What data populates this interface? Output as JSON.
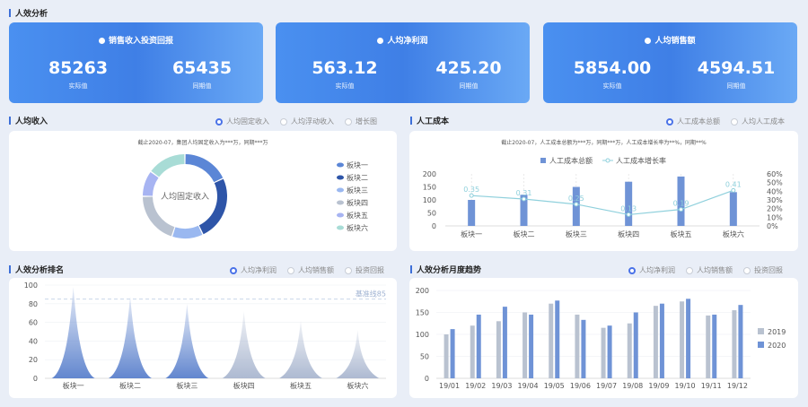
{
  "section_titles": {
    "overview": "人效分析",
    "income": "人均收入",
    "labor_cost": "人工成本",
    "ranking": "人效分析排名",
    "monthly": "人效分析月度趋势"
  },
  "kpis": [
    {
      "title": "销售收入投资回报",
      "actual": "85263",
      "actual_label": "实际值",
      "prior": "65435",
      "prior_label": "同期值"
    },
    {
      "title": "人均净利润",
      "actual": "563.12",
      "actual_label": "实际值",
      "prior": "425.20",
      "prior_label": "同期值"
    },
    {
      "title": "人均销售额",
      "actual": "5854.00",
      "actual_label": "实际值",
      "prior": "4594.51",
      "prior_label": "同期值"
    }
  ],
  "income_panel": {
    "radios": [
      "人均固定收入",
      "人均浮动收入",
      "增长图"
    ],
    "selected": 0,
    "note": "截止2020-07，集团人均固定收入为***万，同期***万"
  },
  "labor_panel": {
    "radios": [
      "人工成本总额",
      "人均人工成本"
    ],
    "selected": 0,
    "note": "截止2020-07，人工成本总额为***万，同期***万，人工成本增长率为**%，同期**%"
  },
  "ranking_panel": {
    "radios": [
      "人均净利润",
      "人均销售额",
      "投资回报"
    ],
    "selected": 0
  },
  "monthly_panel": {
    "radios": [
      "人均净利润",
      "人均销售额",
      "投资回报"
    ],
    "selected": 0
  },
  "colors": {
    "accent": "#4a72e8",
    "dark_blue": "#2e55a8",
    "bar_blue": "#6f93d6",
    "line_cyan": "#8fd0dc"
  },
  "chart_data": [
    {
      "id": "donut",
      "type": "pie",
      "center_label": "人均固定收入",
      "categories": [
        "板块一",
        "板块二",
        "板块三",
        "板块四",
        "板块五",
        "板块六"
      ],
      "values": [
        18,
        25,
        12,
        20,
        10,
        15
      ],
      "colors": [
        "#5b86d6",
        "#2e55a8",
        "#9ab8f0",
        "#b9c2d0",
        "#a7b4f2",
        "#a8dcd6"
      ]
    },
    {
      "id": "labor",
      "type": "bar",
      "categories": [
        "板块一",
        "板块二",
        "板块三",
        "板块四",
        "板块五",
        "板块六"
      ],
      "series": [
        {
          "name": "人工成本总额",
          "type": "bar",
          "values": [
            100,
            120,
            150,
            170,
            190,
            130
          ]
        },
        {
          "name": "人工成本增长率",
          "type": "line",
          "values": [
            0.35,
            0.31,
            0.25,
            0.13,
            0.19,
            0.41
          ],
          "labels": [
            "0.35",
            "0.31",
            "0.25",
            "0.13",
            "0.19",
            "0.41"
          ]
        }
      ],
      "ylim": [
        0,
        200
      ],
      "yticks": [
        "0",
        "50",
        "100",
        "150",
        "200"
      ],
      "y2lim": [
        0,
        0.6
      ],
      "y2ticks": [
        "0%",
        "10%",
        "20%",
        "30%",
        "40%",
        "50%",
        "60%"
      ]
    },
    {
      "id": "ranking",
      "type": "area",
      "categories": [
        "板块一",
        "板块二",
        "板块三",
        "板块四",
        "板块五",
        "板块六"
      ],
      "values": [
        98,
        88,
        80,
        72,
        62,
        52
      ],
      "baseline": 85,
      "baseline_label": "基准线85",
      "ylim": [
        0,
        100
      ],
      "yticks": [
        "0",
        "20",
        "40",
        "60",
        "80",
        "100"
      ],
      "colors": [
        "#5a80cc",
        "#5a80cc",
        "#5a80cc",
        "#a9b6cf",
        "#a9b6cf",
        "#a9b6cf"
      ]
    },
    {
      "id": "monthly",
      "type": "bar",
      "categories": [
        "19/01",
        "19/02",
        "19/03",
        "19/04",
        "19/05",
        "19/06",
        "19/07",
        "19/08",
        "19/09",
        "19/10",
        "19/11",
        "19/12"
      ],
      "series": [
        {
          "name": "2019",
          "values": [
            100,
            120,
            130,
            150,
            170,
            145,
            115,
            125,
            165,
            175,
            143,
            155
          ],
          "color": "#b9c2d0"
        },
        {
          "name": "2020",
          "values": [
            112,
            145,
            163,
            145,
            177,
            133,
            120,
            150,
            170,
            181,
            145,
            167
          ],
          "color": "#6f93d6"
        }
      ],
      "ylim": [
        0,
        200
      ],
      "yticks": [
        "0",
        "50",
        "100",
        "150",
        "200"
      ]
    }
  ]
}
